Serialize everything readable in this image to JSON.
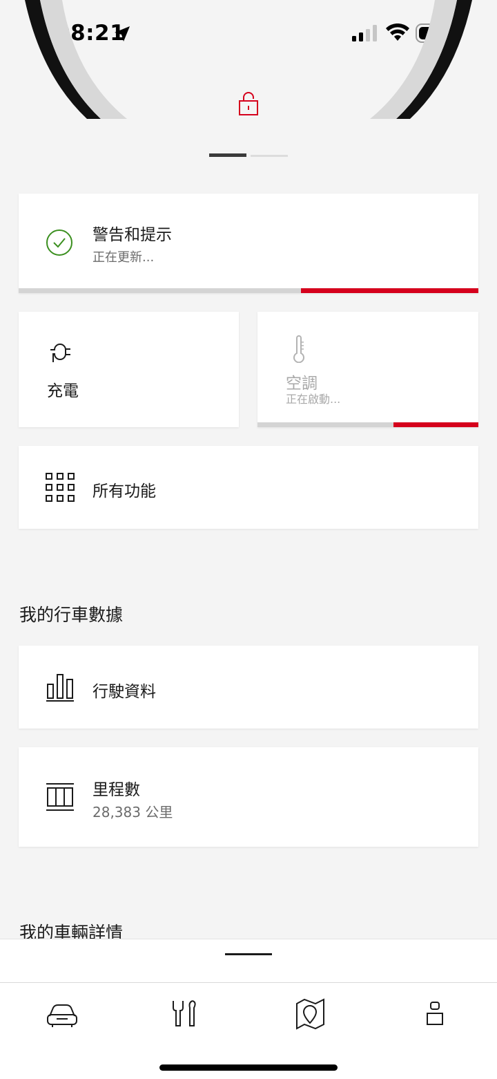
{
  "status_bar": {
    "time": "08:21",
    "icons": [
      "location-arrow-icon",
      "signal-icon",
      "wifi-icon",
      "battery-icon"
    ]
  },
  "vehicle": {
    "lock_icon": "unlocked-padlock-icon",
    "lock_color": "#d5001c",
    "pager": {
      "pages": 2,
      "active_index": 0
    }
  },
  "warnings_card": {
    "title": "警告和提示",
    "subtitle": "正在更新...",
    "icon": "check-circle-icon",
    "icon_color": "#3b8f1f",
    "progress": 0.385
  },
  "charging_card": {
    "title": "充電",
    "icon": "charging-plug-icon"
  },
  "climate_card": {
    "title": "空調",
    "subtitle": "正在啟動...",
    "icon": "thermometer-icon",
    "progress": 0.385
  },
  "all_functions_card": {
    "title": "所有功能",
    "icon": "grid-icon"
  },
  "trip_section": {
    "title": "我的行車數據",
    "trip_data": {
      "title": "行駛資料",
      "icon": "bar-chart-icon"
    },
    "mileage": {
      "title": "里程數",
      "value": "28,383 公里",
      "icon": "odometer-icon"
    }
  },
  "vehicle_details_section": {
    "title": "我的車輛詳情"
  },
  "tab_bar": {
    "tabs": [
      {
        "name": "car",
        "icon": "car-icon"
      },
      {
        "name": "service",
        "icon": "tools-icon"
      },
      {
        "name": "map",
        "icon": "map-pin-icon"
      },
      {
        "name": "profile",
        "icon": "profile-icon"
      }
    ]
  },
  "accent_colors": {
    "red": "#d5001c",
    "green": "#3b8f1f"
  }
}
